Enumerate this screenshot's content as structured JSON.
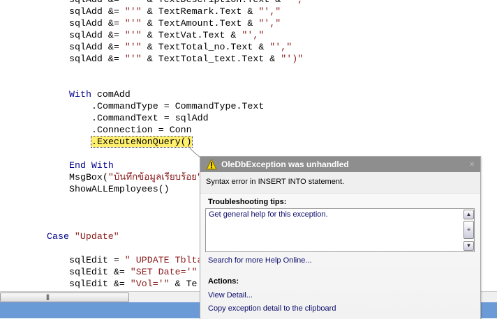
{
  "code_lines": [
    {
      "indent": 12,
      "segments": [
        [
          "t",
          "sqlAdd &= "
        ],
        [
          "s",
          "\"'\""
        ],
        [
          "t",
          " & TextDescription.Text & "
        ],
        [
          "s",
          "\"',\""
        ]
      ]
    },
    {
      "indent": 12,
      "segments": [
        [
          "t",
          "sqlAdd &= "
        ],
        [
          "s",
          "\"'\""
        ],
        [
          "t",
          " & TextRemark.Text & "
        ],
        [
          "s",
          "\"',\""
        ]
      ]
    },
    {
      "indent": 12,
      "segments": [
        [
          "t",
          "sqlAdd &= "
        ],
        [
          "s",
          "\"'\""
        ],
        [
          "t",
          " & TextAmount.Text & "
        ],
        [
          "s",
          "\"',\""
        ]
      ]
    },
    {
      "indent": 12,
      "segments": [
        [
          "t",
          "sqlAdd &= "
        ],
        [
          "s",
          "\"'\""
        ],
        [
          "t",
          " & TextVat.Text & "
        ],
        [
          "s",
          "\"',\""
        ]
      ]
    },
    {
      "indent": 12,
      "segments": [
        [
          "t",
          "sqlAdd &= "
        ],
        [
          "s",
          "\"'\""
        ],
        [
          "t",
          " & TextTotal_no.Text & "
        ],
        [
          "s",
          "\"',\""
        ]
      ]
    },
    {
      "indent": 12,
      "segments": [
        [
          "t",
          "sqlAdd &= "
        ],
        [
          "s",
          "\"'\""
        ],
        [
          "t",
          " & TextTotal_text.Text & "
        ],
        [
          "s",
          "\"')\""
        ]
      ]
    },
    {
      "indent": 12,
      "segments": []
    },
    {
      "indent": 12,
      "segments": []
    },
    {
      "indent": 12,
      "segments": [
        [
          "k",
          "With"
        ],
        [
          "t",
          " comAdd"
        ]
      ]
    },
    {
      "indent": 16,
      "segments": [
        [
          "t",
          ".CommandType = CommandType.Text"
        ]
      ]
    },
    {
      "indent": 16,
      "segments": [
        [
          "t",
          ".CommandText = sqlAdd"
        ]
      ]
    },
    {
      "indent": 16,
      "segments": [
        [
          "t",
          ".Connection = Conn"
        ]
      ]
    },
    {
      "indent": 16,
      "segments": [
        [
          "h",
          ".ExecuteNonQuery()"
        ]
      ]
    },
    {
      "indent": 12,
      "segments": []
    },
    {
      "indent": 12,
      "segments": [
        [
          "k",
          "End With"
        ]
      ]
    },
    {
      "indent": 12,
      "segments": [
        [
          "t",
          "MsgBox("
        ],
        [
          "s",
          "\"บันทึกข้อมูลเรียบร้อย\""
        ]
      ]
    },
    {
      "indent": 12,
      "segments": [
        [
          "t",
          "ShowALLEmployees()"
        ]
      ]
    },
    {
      "indent": 12,
      "segments": []
    },
    {
      "indent": 12,
      "segments": []
    },
    {
      "indent": 12,
      "segments": []
    },
    {
      "indent": 8,
      "segments": [
        [
          "k",
          "Case"
        ],
        [
          "t",
          " "
        ],
        [
          "s",
          "\"Update\""
        ]
      ]
    },
    {
      "indent": 12,
      "segments": []
    },
    {
      "indent": 12,
      "segments": [
        [
          "t",
          "sqlEdit = "
        ],
        [
          "s",
          "\" UPDATE Tblta"
        ]
      ]
    },
    {
      "indent": 12,
      "segments": [
        [
          "t",
          "sqlEdit &= "
        ],
        [
          "s",
          "\"SET Date='\""
        ]
      ]
    },
    {
      "indent": 12,
      "segments": [
        [
          "t",
          "sqlEdit &= "
        ],
        [
          "s",
          "\"Vol='\""
        ],
        [
          "t",
          " & Te"
        ]
      ]
    }
  ],
  "popup": {
    "title": "OleDbException was unhandled",
    "close": "×",
    "message": "Syntax error in INSERT INTO statement.",
    "tips_heading": "Troubleshooting tips:",
    "tip": "Get general help for this exception.",
    "search_link": "Search for more Help Online...",
    "actions_heading": "Actions:",
    "actions": [
      "View Detail...",
      "Copy exception detail to the clipboard"
    ]
  },
  "colors": {
    "keyword": "#00008b",
    "string": "#8b1a1a",
    "highlight": "#ffef6f",
    "title_bar": "#8e8e8e"
  }
}
